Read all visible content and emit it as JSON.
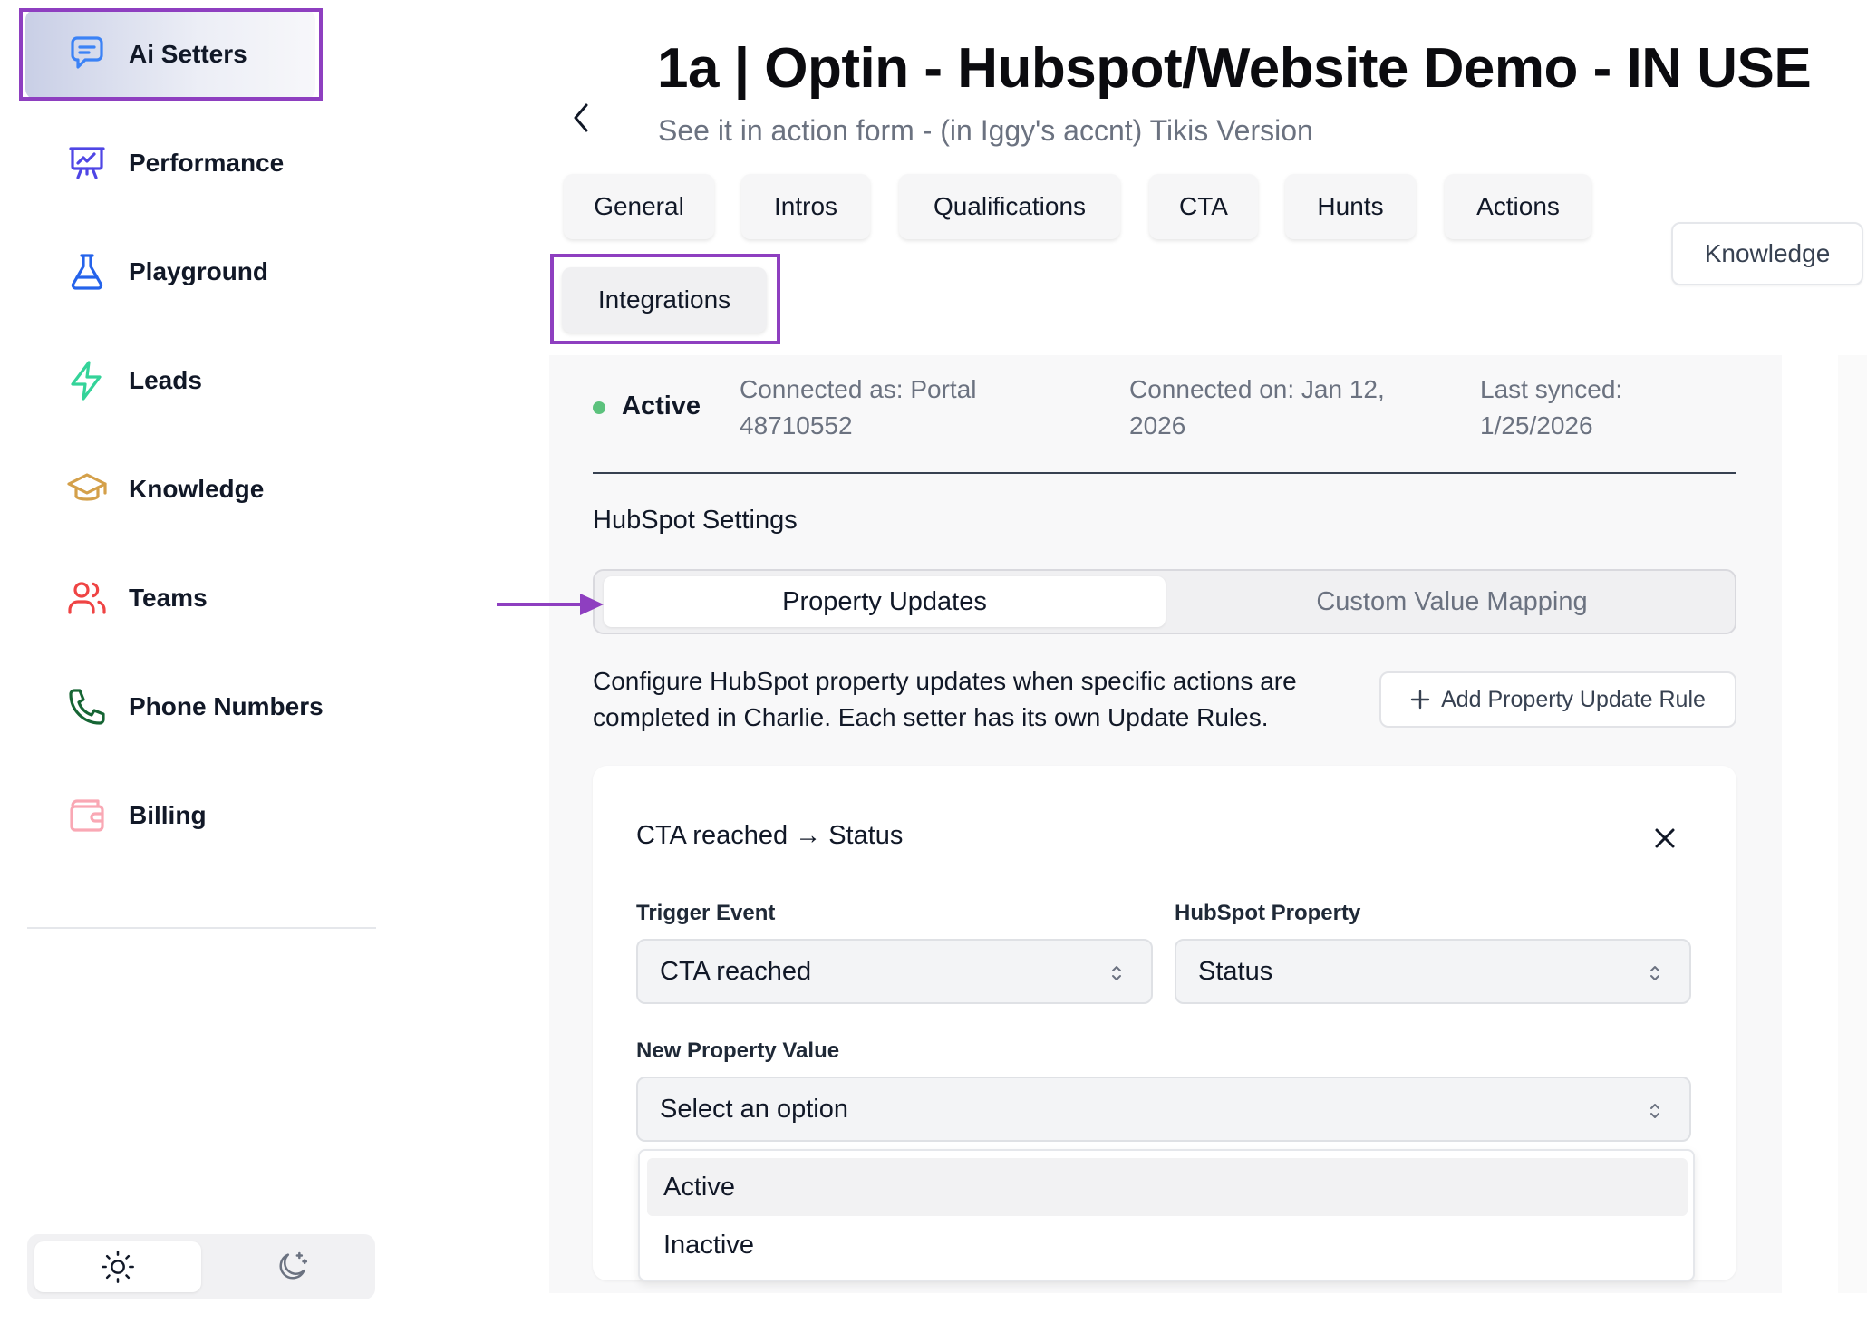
{
  "sidebar": {
    "items": [
      {
        "label": "Ai Setters",
        "icon": "chat-bubble-icon"
      },
      {
        "label": "Performance",
        "icon": "presentation-chart-icon"
      },
      {
        "label": "Playground",
        "icon": "flask-icon"
      },
      {
        "label": "Leads",
        "icon": "lightning-icon"
      },
      {
        "label": "Knowledge",
        "icon": "graduation-cap-icon"
      },
      {
        "label": "Teams",
        "icon": "users-icon"
      },
      {
        "label": "Phone Numbers",
        "icon": "phone-icon"
      },
      {
        "label": "Billing",
        "icon": "wallet-icon"
      }
    ],
    "active_item": "Ai Setters",
    "theme_toggle": {
      "options": [
        "light",
        "dark"
      ],
      "selected": "light"
    }
  },
  "header": {
    "title": "1a | Optin - Hubspot/Website Demo - IN USE",
    "subtitle": "See it in action form - (in Iggy's accnt) Tikis Version"
  },
  "tabs": {
    "items": [
      "General",
      "Intros",
      "Qualifications",
      "CTA",
      "Hunts",
      "Actions",
      "Integrations"
    ],
    "active": "Integrations",
    "knowledge_button": "Knowledge"
  },
  "integration": {
    "status": "Active",
    "connected_as": "Connected as: Portal 48710552",
    "connected_as_line1": "Connected as: Portal",
    "connected_as_line2": "48710552",
    "connected_on_line1": "Connected on: Jan 12,",
    "connected_on_line2": "2026",
    "last_synced_line1": "Last synced:",
    "last_synced_line2": "1/25/2026",
    "section_heading": "HubSpot Settings",
    "subtabs": {
      "property_updates": "Property Updates",
      "custom_value_mapping": "Custom Value Mapping",
      "selected": "Property Updates"
    },
    "description": "Configure HubSpot property updates when specific actions are completed in Charlie. Each setter has its own Update Rules.",
    "add_rule_button": "Add Property Update Rule"
  },
  "rule": {
    "title": "CTA reached → Status",
    "trigger_label": "Trigger Event",
    "trigger_value": "CTA reached",
    "property_label": "HubSpot Property",
    "property_value": "Status",
    "new_value_label": "New Property Value",
    "new_value_placeholder": "Select an option",
    "options": [
      "Active",
      "Inactive"
    ],
    "highlighted_option": "Active"
  },
  "colors": {
    "annotation": "#8e3fc0",
    "status_green": "#5cc27d",
    "active_nav_gradient": "#c9cfe6"
  }
}
